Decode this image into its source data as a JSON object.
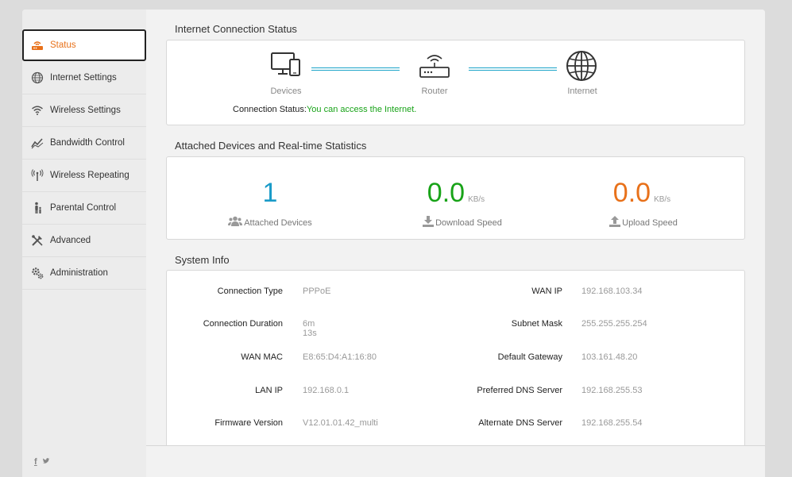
{
  "sidebar": {
    "items": [
      {
        "label": "Status",
        "icon": "router-status-icon",
        "active": true
      },
      {
        "label": "Internet Settings",
        "icon": "globe-icon"
      },
      {
        "label": "Wireless Settings",
        "icon": "wifi-icon"
      },
      {
        "label": "Bandwidth Control",
        "icon": "chart-line-icon"
      },
      {
        "label": "Wireless Repeating",
        "icon": "antenna-icon"
      },
      {
        "label": "Parental Control",
        "icon": "parent-child-icon"
      },
      {
        "label": "Advanced",
        "icon": "tools-icon"
      },
      {
        "label": "Administration",
        "icon": "gears-icon"
      }
    ],
    "social": {
      "facebook": "f",
      "twitter": "t"
    }
  },
  "connection": {
    "title": "Internet Connection Status",
    "devices_label": "Devices",
    "router_label": "Router",
    "internet_label": "Internet",
    "status_key": "Connection Status:",
    "status_value": "You can access the Internet."
  },
  "stats": {
    "title": "Attached Devices and Real-time Statistics",
    "attached_count": "1",
    "attached_label": "Attached Devices",
    "download_value": "0.0",
    "download_unit": "KB/s",
    "download_label": "Download Speed",
    "upload_value": "0.0",
    "upload_unit": "KB/s",
    "upload_label": "Upload Speed"
  },
  "sysinfo": {
    "title": "System Info",
    "left": [
      {
        "key": "Connection Type",
        "value": "PPPoE"
      },
      {
        "key": "Connection Duration",
        "value": "6m 13s"
      },
      {
        "key": "WAN MAC",
        "value": "E8:65:D4:A1:16:80"
      },
      {
        "key": "LAN IP",
        "value": "192.168.0.1"
      },
      {
        "key": "Firmware Version",
        "value": "V12.01.01.42_multi"
      }
    ],
    "right": [
      {
        "key": "WAN IP",
        "value": "192.168.103.34"
      },
      {
        "key": "Subnet Mask",
        "value": "255.255.255.254"
      },
      {
        "key": "Default Gateway",
        "value": "103.161.48.20"
      },
      {
        "key": "Preferred DNS Server",
        "value": "192.168.255.53"
      },
      {
        "key": "Alternate DNS Server",
        "value": "192.168.255.54"
      }
    ]
  },
  "colors": {
    "accent": "#e8711a",
    "blue": "#1a9bc8",
    "green": "#18a318",
    "orange": "#e8711a"
  }
}
